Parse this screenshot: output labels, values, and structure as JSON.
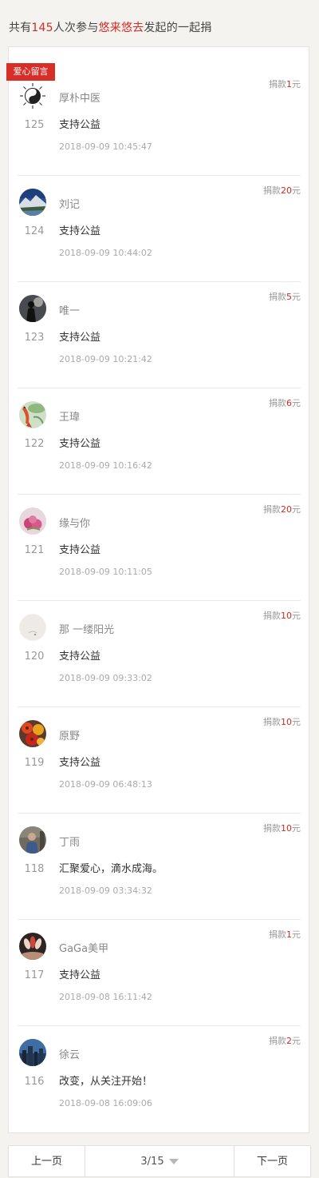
{
  "header": {
    "prefix": "共有",
    "count": "145",
    "mid": "人次参与",
    "initiator": "悠来悠去",
    "suffix": "发起的一起捐"
  },
  "ribbon": "爱心留言",
  "colors": {
    "accent": "#d12b23",
    "background": "#f5f3ef"
  },
  "entries": [
    {
      "name": "厚朴中医",
      "index": "125",
      "message": "支持公益",
      "time": "2018-09-09 10:45:47",
      "amount_prefix": "捐款",
      "amount": "1",
      "amount_unit": "元",
      "avatar": "yin-yang-icon"
    },
    {
      "name": "刘记",
      "index": "124",
      "message": "支持公益",
      "time": "2018-09-09 10:44:02",
      "amount_prefix": "捐款",
      "amount": "20",
      "amount_unit": "元",
      "avatar": "mountain-landscape-avatar"
    },
    {
      "name": "唯一",
      "index": "123",
      "message": "支持公益",
      "time": "2018-09-09 10:21:42",
      "amount_prefix": "捐款",
      "amount": "5",
      "amount_unit": "元",
      "avatar": "silhouette-avatar"
    },
    {
      "name": "王瑋",
      "index": "122",
      "message": "支持公益",
      "time": "2018-09-09 10:16:42",
      "amount_prefix": "捐款",
      "amount": "6",
      "amount_unit": "元",
      "avatar": "koi-fish-avatar"
    },
    {
      "name": "缘与你",
      "index": "121",
      "message": "支持公益",
      "time": "2018-09-09 10:11:05",
      "amount_prefix": "捐款",
      "amount": "20",
      "amount_unit": "元",
      "avatar": "pink-flower-avatar"
    },
    {
      "name": "那 一缕阳光",
      "index": "120",
      "message": "支持公益",
      "time": "2018-09-09 09:33:02",
      "amount_prefix": "捐款",
      "amount": "10",
      "amount_unit": "元",
      "avatar": "light-sketch-avatar"
    },
    {
      "name": "原野",
      "index": "119",
      "message": "支持公益",
      "time": "2018-09-09 06:48:13",
      "amount_prefix": "捐款",
      "amount": "10",
      "amount_unit": "元",
      "avatar": "red-flowers-avatar"
    },
    {
      "name": "丁雨",
      "index": "118",
      "message": "汇聚爱心，滴水成海。",
      "time": "2018-09-09 03:34:32",
      "amount_prefix": "捐款",
      "amount": "10",
      "amount_unit": "元",
      "avatar": "person-photo-avatar"
    },
    {
      "name": "GaGa美甲",
      "index": "117",
      "message": "支持公益",
      "time": "2018-09-08 16:11:42",
      "amount_prefix": "捐款",
      "amount": "1",
      "amount_unit": "元",
      "avatar": "nails-avatar"
    },
    {
      "name": "徐云",
      "index": "116",
      "message": "改变，从关注开始！",
      "time": "2018-09-08 16:09:06",
      "amount_prefix": "捐款",
      "amount": "2",
      "amount_unit": "元",
      "avatar": "city-skyline-avatar"
    }
  ],
  "pager": {
    "prev": "上一页",
    "current": "3/15",
    "next": "下一页"
  }
}
